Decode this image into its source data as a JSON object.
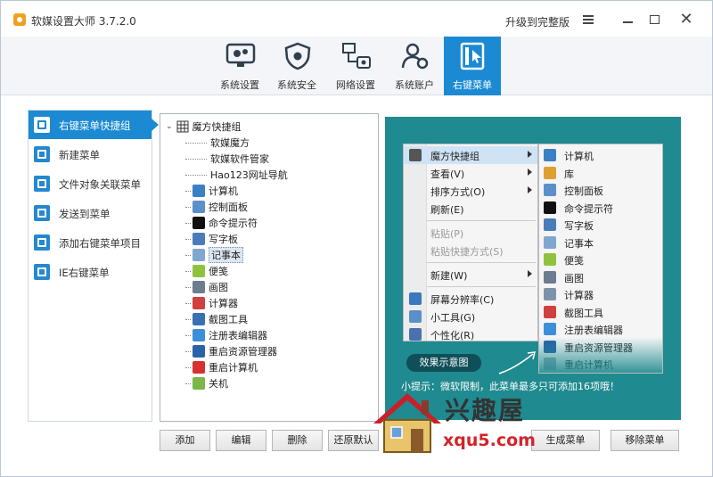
{
  "app": {
    "title": "软媒设置大师 3.7.2.0",
    "upgrade": "升级到完整版"
  },
  "topnav": {
    "tabs": [
      {
        "label": "系统设置",
        "icon": "settings-monitor-icon"
      },
      {
        "label": "系统安全",
        "icon": "shield-icon"
      },
      {
        "label": "网络设置",
        "icon": "network-icon"
      },
      {
        "label": "系统账户",
        "icon": "users-icon"
      },
      {
        "label": "右键菜单",
        "icon": "cursor-click-icon",
        "active": true
      }
    ]
  },
  "sidebar": {
    "items": [
      {
        "label": "右键菜单快捷组",
        "active": true
      },
      {
        "label": "新建菜单"
      },
      {
        "label": "文件对象关联菜单"
      },
      {
        "label": "发送到菜单"
      },
      {
        "label": "添加右键菜单项目"
      },
      {
        "label": "IE右键菜单"
      }
    ]
  },
  "tree": {
    "root": "魔方快捷组",
    "items": [
      {
        "label": "软媒魔方",
        "icon": "none"
      },
      {
        "label": "软媒软件管家",
        "icon": "none"
      },
      {
        "label": "Hao123网址导航",
        "icon": "none"
      },
      {
        "label": "计算机",
        "icon": "computer-icon",
        "color": "#3b7fc4"
      },
      {
        "label": "控制面板",
        "icon": "control-panel-icon",
        "color": "#5a8fc9"
      },
      {
        "label": "命令提示符",
        "icon": "cmd-icon",
        "color": "#111111"
      },
      {
        "label": "写字板",
        "icon": "wordpad-icon",
        "color": "#4a7db8"
      },
      {
        "label": "记事本",
        "icon": "notepad-icon",
        "color": "#7fa7cf",
        "selected": true
      },
      {
        "label": "便笺",
        "icon": "sticky-notes-icon",
        "color": "#8fc33f"
      },
      {
        "label": "画图",
        "icon": "paint-icon",
        "color": "#6b7d8f"
      },
      {
        "label": "计算器",
        "icon": "calculator-icon",
        "color": "#d04040"
      },
      {
        "label": "截图工具",
        "icon": "snipping-tool-icon",
        "color": "#3a6fb0"
      },
      {
        "label": "注册表编辑器",
        "icon": "registry-icon",
        "color": "#3c8fd8"
      },
      {
        "label": "重启资源管理器",
        "icon": "restart-explorer-icon",
        "color": "#2a62a8"
      },
      {
        "label": "重启计算机",
        "icon": "restart-computer-icon",
        "color": "#d83030"
      },
      {
        "label": "关机",
        "icon": "shutdown-icon",
        "color": "#7ab648"
      }
    ]
  },
  "preview": {
    "menu": [
      {
        "label": "魔方快捷组",
        "arrow": true,
        "highlight": true
      },
      {
        "label": "查看(V)",
        "arrow": true
      },
      {
        "label": "排序方式(O)",
        "arrow": true
      },
      {
        "label": "刷新(E)"
      },
      {
        "label": "粘贴(P)",
        "disabled": true
      },
      {
        "label": "粘贴快捷方式(S)",
        "disabled": true
      },
      {
        "label": "新建(W)",
        "arrow": true
      },
      {
        "label": "屏幕分辨率(C)"
      },
      {
        "label": "小工具(G)"
      },
      {
        "label": "个性化(R)"
      }
    ],
    "submenu": [
      "计算机",
      "库",
      "控制面板",
      "命令提示符",
      "写字板",
      "记事本",
      "便笺",
      "画图",
      "计算器",
      "截图工具",
      "注册表编辑器",
      "重启资源管理器",
      "重启计算机"
    ],
    "effect_label": "效果示意图",
    "tip": "小提示：微软限制，此菜单最多只可添加16项哦！"
  },
  "buttons": {
    "add": "添加",
    "edit": "编辑",
    "delete": "删除",
    "restore": "还原默认",
    "generate": "生成菜单",
    "remove": "移除菜单"
  },
  "watermark": {
    "cn": "兴趣屋",
    "url": "xqu5.com"
  }
}
